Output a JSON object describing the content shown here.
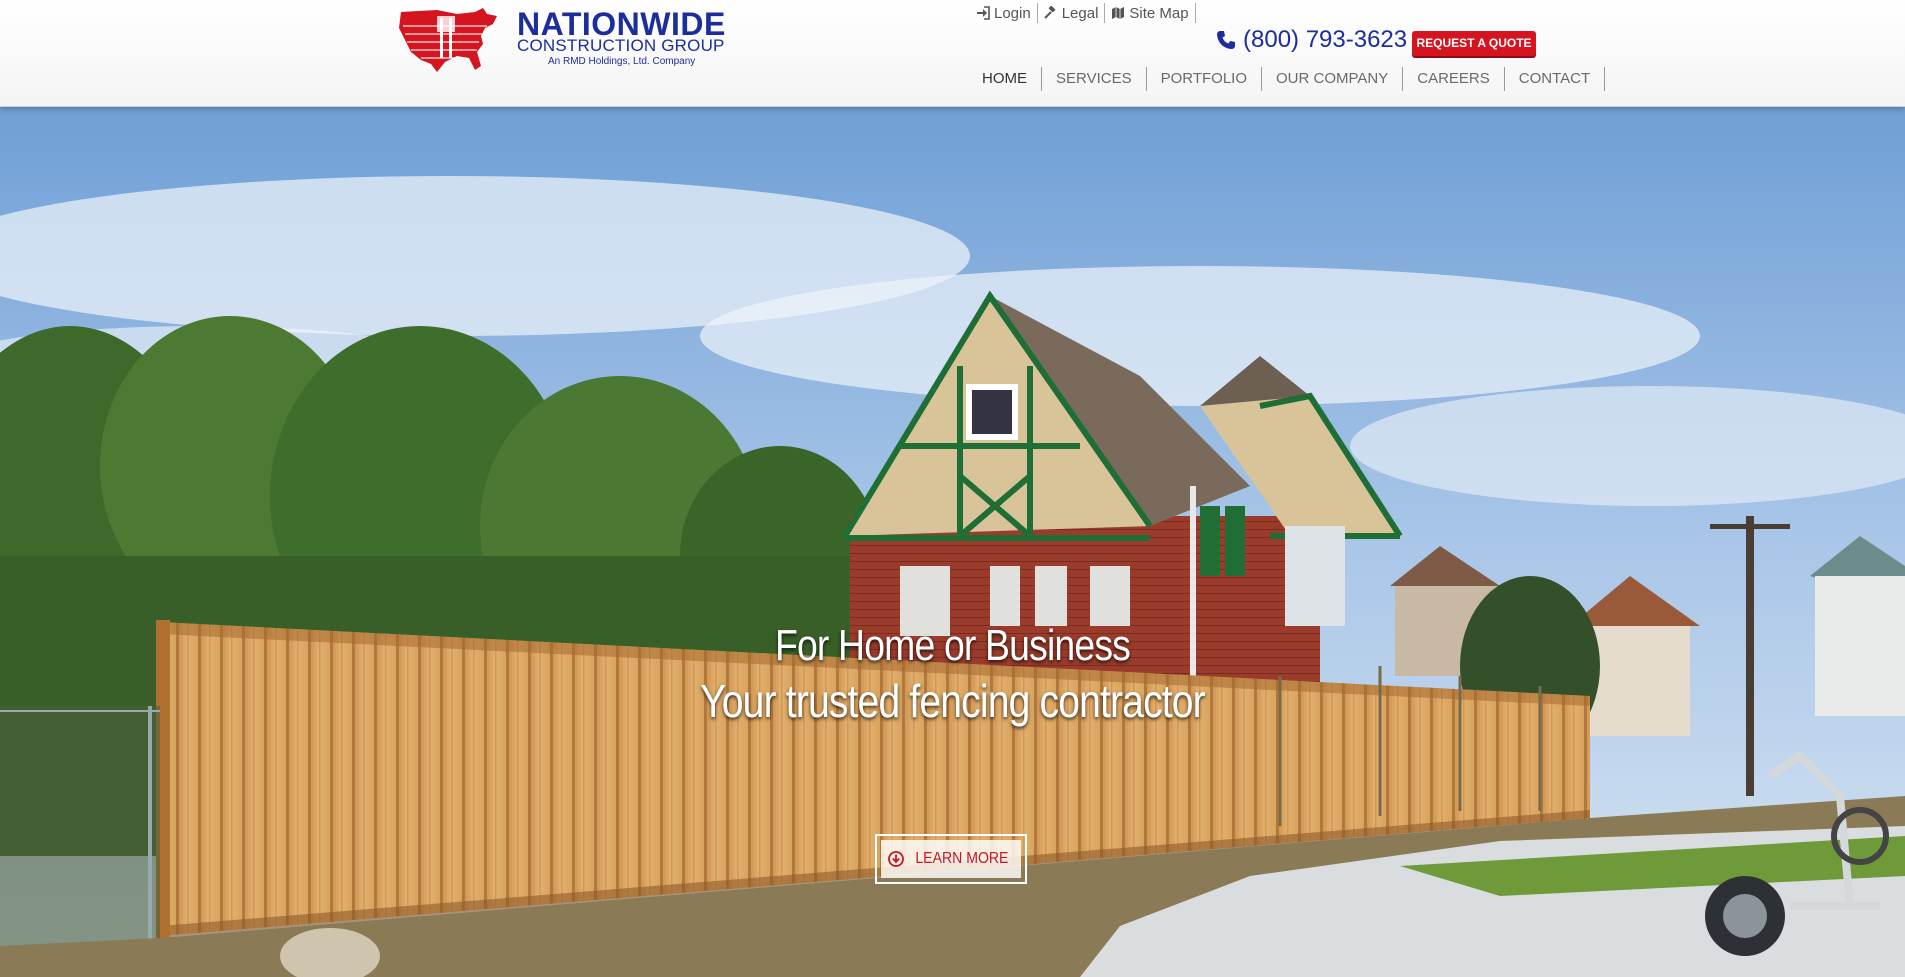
{
  "brand": {
    "name": "NATIONWIDE",
    "subtitle": "CONSTRUCTION GROUP",
    "tagline": "An RMD Holdings, Ltd. Company",
    "color": "#1c2d9c",
    "logo_icon": "usa-map-flag-icon"
  },
  "utility_links": [
    {
      "label": "Login",
      "icon": "sign-in-icon"
    },
    {
      "label": "Legal",
      "icon": "gavel-icon"
    },
    {
      "label": "Site Map",
      "icon": "map-icon"
    }
  ],
  "contact": {
    "phone": "(800) 793-3623",
    "phone_icon": "phone-icon",
    "quote_button": "REQUEST A QUOTE",
    "quote_color": "#d4141f"
  },
  "nav": {
    "items": [
      "HOME",
      "SERVICES",
      "PORTFOLIO",
      "OUR COMPANY",
      "CAREERS",
      "CONTACT"
    ],
    "active": "HOME"
  },
  "hero": {
    "headline": "For Home or Business",
    "subheadline": "Your trusted fencing contractor",
    "button_label": "LEARN MORE",
    "button_icon": "arrow-circle-down-icon"
  }
}
